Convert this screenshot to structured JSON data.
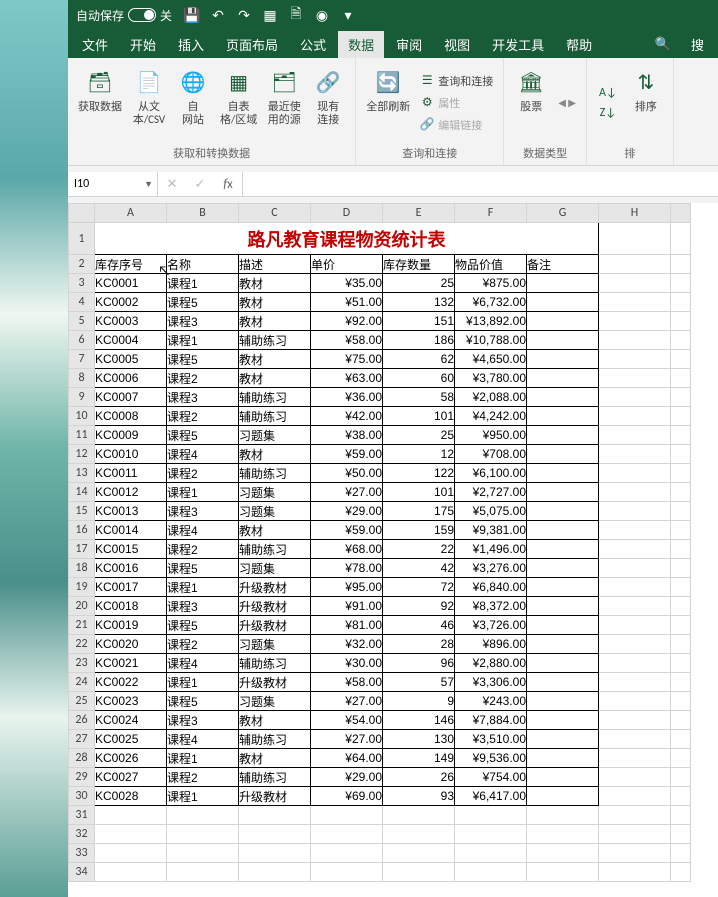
{
  "titlebar": {
    "autosave_label": "自动保存",
    "autosave_state": "关"
  },
  "menu": {
    "file": "文件",
    "home": "开始",
    "insert": "插入",
    "layout": "页面布局",
    "formula": "公式",
    "data": "数据",
    "review": "审阅",
    "view": "视图",
    "devtools": "开发工具",
    "help": "帮助",
    "search": "搜"
  },
  "ribbon": {
    "get_data": "获取数据",
    "from_text": "从文\n本/CSV",
    "from_web": "自\n网站",
    "from_table": "自表\n格/区域",
    "recent": "最近使\n用的源",
    "existing": "现有\n连接",
    "group1": "获取和转换数据",
    "refresh_all": "全部刷新",
    "queries": "查询和连接",
    "properties": "属性",
    "edit_links": "编辑链接",
    "group2": "查询和连接",
    "stocks": "股票",
    "group3": "数据类型",
    "sort": "排序",
    "group4": "排"
  },
  "formula_bar": {
    "name_box": "I10"
  },
  "columns": [
    "A",
    "B",
    "C",
    "D",
    "E",
    "F",
    "G",
    "H"
  ],
  "sheet": {
    "title": "路凡教育课程物资统计表",
    "headers": {
      "c1": "库存序号",
      "c2": "名称",
      "c3": "描述",
      "c4": "单价",
      "c5": "库存数量",
      "c6": "物品价值",
      "c7": "备注"
    },
    "rows": [
      {
        "id": "KC0001",
        "name": "课程1",
        "desc": "教材",
        "price": "¥35.00",
        "qty": "25",
        "value": "¥875.00"
      },
      {
        "id": "KC0002",
        "name": "课程5",
        "desc": "教材",
        "price": "¥51.00",
        "qty": "132",
        "value": "¥6,732.00"
      },
      {
        "id": "KC0003",
        "name": "课程3",
        "desc": "教材",
        "price": "¥92.00",
        "qty": "151",
        "value": "¥13,892.00"
      },
      {
        "id": "KC0004",
        "name": "课程1",
        "desc": "辅助练习",
        "price": "¥58.00",
        "qty": "186",
        "value": "¥10,788.00"
      },
      {
        "id": "KC0005",
        "name": "课程5",
        "desc": "教材",
        "price": "¥75.00",
        "qty": "62",
        "value": "¥4,650.00"
      },
      {
        "id": "KC0006",
        "name": "课程2",
        "desc": "教材",
        "price": "¥63.00",
        "qty": "60",
        "value": "¥3,780.00"
      },
      {
        "id": "KC0007",
        "name": "课程3",
        "desc": "辅助练习",
        "price": "¥36.00",
        "qty": "58",
        "value": "¥2,088.00"
      },
      {
        "id": "KC0008",
        "name": "课程2",
        "desc": "辅助练习",
        "price": "¥42.00",
        "qty": "101",
        "value": "¥4,242.00"
      },
      {
        "id": "KC0009",
        "name": "课程5",
        "desc": "习题集",
        "price": "¥38.00",
        "qty": "25",
        "value": "¥950.00"
      },
      {
        "id": "KC0010",
        "name": "课程4",
        "desc": "教材",
        "price": "¥59.00",
        "qty": "12",
        "value": "¥708.00"
      },
      {
        "id": "KC0011",
        "name": "课程2",
        "desc": "辅助练习",
        "price": "¥50.00",
        "qty": "122",
        "value": "¥6,100.00"
      },
      {
        "id": "KC0012",
        "name": "课程1",
        "desc": "习题集",
        "price": "¥27.00",
        "qty": "101",
        "value": "¥2,727.00"
      },
      {
        "id": "KC0013",
        "name": "课程3",
        "desc": "习题集",
        "price": "¥29.00",
        "qty": "175",
        "value": "¥5,075.00"
      },
      {
        "id": "KC0014",
        "name": "课程4",
        "desc": "教材",
        "price": "¥59.00",
        "qty": "159",
        "value": "¥9,381.00"
      },
      {
        "id": "KC0015",
        "name": "课程2",
        "desc": "辅助练习",
        "price": "¥68.00",
        "qty": "22",
        "value": "¥1,496.00"
      },
      {
        "id": "KC0016",
        "name": "课程5",
        "desc": "习题集",
        "price": "¥78.00",
        "qty": "42",
        "value": "¥3,276.00"
      },
      {
        "id": "KC0017",
        "name": "课程1",
        "desc": "升级教材",
        "price": "¥95.00",
        "qty": "72",
        "value": "¥6,840.00"
      },
      {
        "id": "KC0018",
        "name": "课程3",
        "desc": "升级教材",
        "price": "¥91.00",
        "qty": "92",
        "value": "¥8,372.00"
      },
      {
        "id": "KC0019",
        "name": "课程5",
        "desc": "升级教材",
        "price": "¥81.00",
        "qty": "46",
        "value": "¥3,726.00"
      },
      {
        "id": "KC0020",
        "name": "课程2",
        "desc": "习题集",
        "price": "¥32.00",
        "qty": "28",
        "value": "¥896.00"
      },
      {
        "id": "KC0021",
        "name": "课程4",
        "desc": "辅助练习",
        "price": "¥30.00",
        "qty": "96",
        "value": "¥2,880.00"
      },
      {
        "id": "KC0022",
        "name": "课程1",
        "desc": "升级教材",
        "price": "¥58.00",
        "qty": "57",
        "value": "¥3,306.00"
      },
      {
        "id": "KC0023",
        "name": "课程5",
        "desc": "习题集",
        "price": "¥27.00",
        "qty": "9",
        "value": "¥243.00"
      },
      {
        "id": "KC0024",
        "name": "课程3",
        "desc": "教材",
        "price": "¥54.00",
        "qty": "146",
        "value": "¥7,884.00"
      },
      {
        "id": "KC0025",
        "name": "课程4",
        "desc": "辅助练习",
        "price": "¥27.00",
        "qty": "130",
        "value": "¥3,510.00"
      },
      {
        "id": "KC0026",
        "name": "课程1",
        "desc": "教材",
        "price": "¥64.00",
        "qty": "149",
        "value": "¥9,536.00"
      },
      {
        "id": "KC0027",
        "name": "课程2",
        "desc": "辅助练习",
        "price": "¥29.00",
        "qty": "26",
        "value": "¥754.00"
      },
      {
        "id": "KC0028",
        "name": "课程1",
        "desc": "升级教材",
        "price": "¥69.00",
        "qty": "93",
        "value": "¥6,417.00"
      }
    ]
  }
}
